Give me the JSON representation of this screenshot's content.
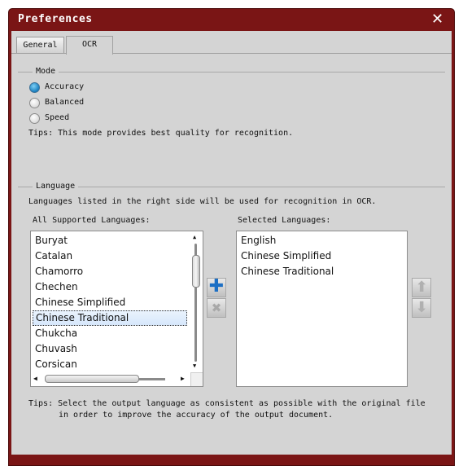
{
  "window": {
    "title": "Preferences",
    "close_icon": "close-icon"
  },
  "tabs": [
    {
      "label": "General",
      "active": false
    },
    {
      "label": "OCR",
      "active": true
    }
  ],
  "mode": {
    "section_label": "Mode",
    "options": [
      {
        "label": "Accuracy",
        "selected": true
      },
      {
        "label": "Balanced",
        "selected": false
      },
      {
        "label": "Speed",
        "selected": false
      }
    ],
    "tips": "Tips: This mode provides best quality for recognition."
  },
  "language": {
    "section_label": "Language",
    "description": "Languages listed in the right side will be used for recognition in OCR.",
    "all_label": "All Supported Languages:",
    "selected_label": "Selected Languages:",
    "all_languages": [
      "Buryat",
      "Catalan",
      "Chamorro",
      "Chechen",
      "Chinese Simplified",
      "Chinese Traditional",
      "Chukcha",
      "Chuvash",
      "Corsican"
    ],
    "highlighted": "Chinese Traditional",
    "selected_languages": [
      "English",
      "Chinese Simplified",
      "Chinese Traditional"
    ],
    "tips_line1": "Tips: Select the output language as consistent as possible with the original file",
    "tips_line2": "in order to improve the accuracy of the output document.",
    "accent_color": "#1a7fbf"
  }
}
